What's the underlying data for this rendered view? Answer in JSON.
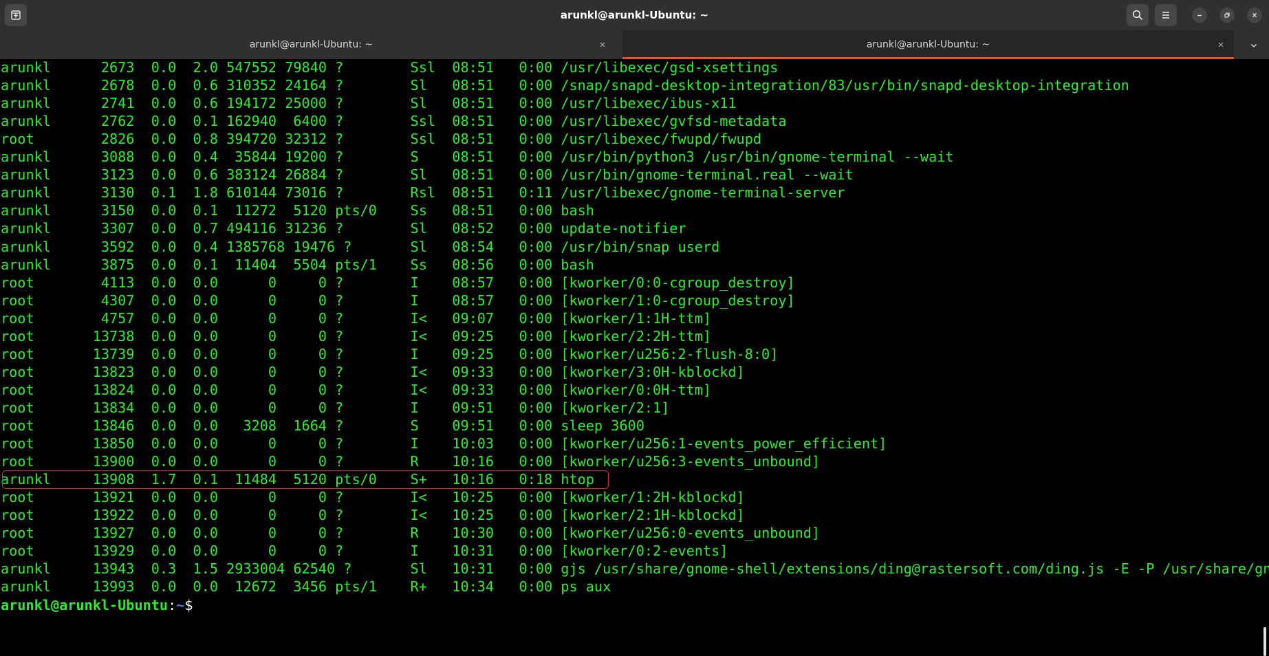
{
  "window": {
    "title": "arunkl@arunkl-Ubuntu: ~"
  },
  "tabs": [
    {
      "label": "arunkl@arunkl-Ubuntu: ~",
      "active": false
    },
    {
      "label": "arunkl@arunkl-Ubuntu: ~",
      "active": true
    }
  ],
  "colors": {
    "accent": "#e95420",
    "terminal_text": "#2bed2b",
    "highlight_box": "#e0272a",
    "prompt_path": "#3a7ed0"
  },
  "icons": {
    "new_tab": "new-tab-icon",
    "search": "search-icon",
    "menu": "hamburger-menu-icon",
    "minimize": "minimize-icon",
    "maximize": "restore-icon",
    "close": "close-icon",
    "tab_close": "close-icon",
    "tabs_menu": "chevron-down-icon"
  },
  "terminal": {
    "highlighted_row_index": 23,
    "rows": [
      "arunkl      2673  0.0  2.0 547552 79840 ?        Ssl  08:51   0:00 /usr/libexec/gsd-xsettings",
      "arunkl      2678  0.0  0.6 310352 24164 ?        Sl   08:51   0:00 /snap/snapd-desktop-integration/83/usr/bin/snapd-desktop-integration",
      "arunkl      2741  0.0  0.6 194172 25000 ?        Sl   08:51   0:00 /usr/libexec/ibus-x11",
      "arunkl      2762  0.0  0.1 162940  6400 ?        Ssl  08:51   0:00 /usr/libexec/gvfsd-metadata",
      "root        2826  0.0  0.8 394720 32312 ?        Ssl  08:51   0:00 /usr/libexec/fwupd/fwupd",
      "arunkl      3088  0.0  0.4  35844 19200 ?        S    08:51   0:00 /usr/bin/python3 /usr/bin/gnome-terminal --wait",
      "arunkl      3123  0.0  0.6 383124 26884 ?        Sl   08:51   0:00 /usr/bin/gnome-terminal.real --wait",
      "arunkl      3130  0.1  1.8 610144 73016 ?        Rsl  08:51   0:11 /usr/libexec/gnome-terminal-server",
      "arunkl      3150  0.0  0.1  11272  5120 pts/0    Ss   08:51   0:00 bash",
      "arunkl      3307  0.0  0.7 494116 31236 ?        Sl   08:52   0:00 update-notifier",
      "arunkl      3592  0.0  0.4 1385768 19476 ?       Sl   08:54   0:00 /usr/bin/snap userd",
      "arunkl      3875  0.0  0.1  11404  5504 pts/1    Ss   08:56   0:00 bash",
      "root        4113  0.0  0.0      0     0 ?        I    08:57   0:00 [kworker/0:0-cgroup_destroy]",
      "root        4307  0.0  0.0      0     0 ?        I    08:57   0:00 [kworker/1:0-cgroup_destroy]",
      "root        4757  0.0  0.0      0     0 ?        I<   09:07   0:00 [kworker/1:1H-ttm]",
      "root       13738  0.0  0.0      0     0 ?        I<   09:25   0:00 [kworker/2:2H-ttm]",
      "root       13739  0.0  0.0      0     0 ?        I    09:25   0:00 [kworker/u256:2-flush-8:0]",
      "root       13823  0.0  0.0      0     0 ?        I<   09:33   0:00 [kworker/3:0H-kblockd]",
      "root       13824  0.0  0.0      0     0 ?        I<   09:33   0:00 [kworker/0:0H-ttm]",
      "root       13834  0.0  0.0      0     0 ?        I    09:51   0:00 [kworker/2:1]",
      "root       13846  0.0  0.0   3208  1664 ?        S    09:51   0:00 sleep 3600",
      "root       13850  0.0  0.0      0     0 ?        I    10:03   0:00 [kworker/u256:1-events_power_efficient]",
      "root       13900  0.0  0.0      0     0 ?        R    10:16   0:00 [kworker/u256:3-events_unbound]",
      "arunkl     13908  1.7  0.1  11484  5120 pts/0    S+   10:16   0:18 htop",
      "root       13921  0.0  0.0      0     0 ?        I<   10:25   0:00 [kworker/1:2H-kblockd]",
      "root       13922  0.0  0.0      0     0 ?        I<   10:25   0:00 [kworker/2:1H-kblockd]",
      "root       13927  0.0  0.0      0     0 ?        R    10:30   0:00 [kworker/u256:0-events_unbound]",
      "root       13929  0.0  0.0      0     0 ?        I    10:31   0:00 [kworker/0:2-events]",
      "arunkl     13943  0.3  1.5 2933004 62540 ?       Sl   10:31   0:00 gjs /usr/share/gnome-shell/extensions/ding@rastersoft.com/ding.js -E -P /usr/share/gn",
      "arunkl     13993  0.0  0.0  12672  3456 pts/1    R+   10:34   0:00 ps aux"
    ],
    "prompt": {
      "user_host": "arunkl@arunkl-Ubuntu",
      "colon": ":",
      "path": "~",
      "symbol": "$"
    }
  }
}
